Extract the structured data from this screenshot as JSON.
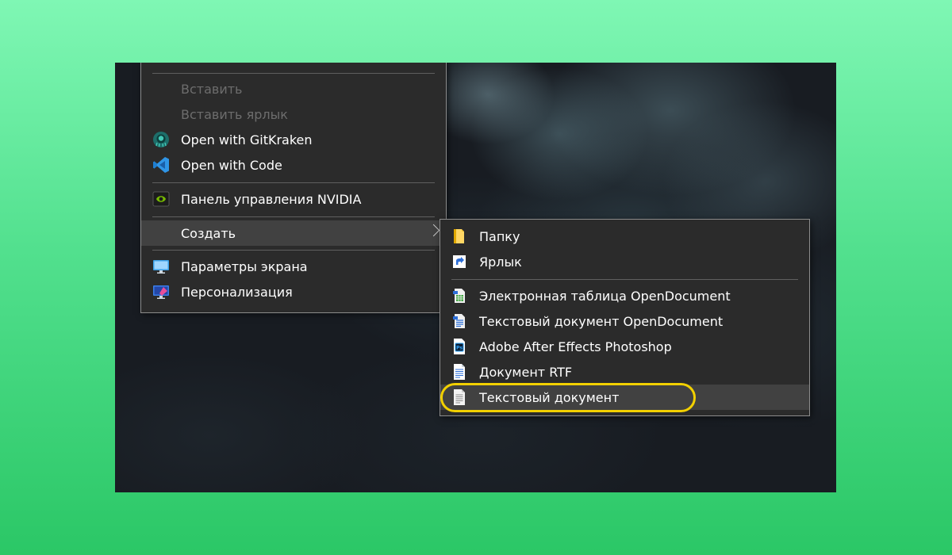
{
  "main_menu": {
    "items": [
      {
        "label": "Вставить",
        "enabled": false
      },
      {
        "label": "Вставить ярлык",
        "enabled": false
      },
      {
        "label": "Open with GitKraken",
        "icon": "gitkraken-icon"
      },
      {
        "label": "Open with Code",
        "icon": "vscode-icon"
      },
      {
        "label": "Панель управления NVIDIA",
        "icon": "nvidia-icon"
      },
      {
        "label": "Создать",
        "submenu": true
      },
      {
        "label": "Параметры экрана",
        "icon": "display-icon"
      },
      {
        "label": "Персонализация",
        "icon": "personalization-icon"
      }
    ]
  },
  "sub_menu": {
    "items": [
      {
        "label": "Папку",
        "icon": "folder-icon"
      },
      {
        "label": "Ярлык",
        "icon": "shortcut-icon"
      },
      {
        "label": "Электронная таблица OpenDocument",
        "icon": "ods-icon"
      },
      {
        "label": "Текстовый документ OpenDocument",
        "icon": "odt-icon"
      },
      {
        "label": "Adobe After Effects Photoshop",
        "icon": "photoshop-icon"
      },
      {
        "label": "Документ RTF",
        "icon": "rtf-icon"
      },
      {
        "label": "Текстовый документ",
        "icon": "text-document-icon",
        "highlighted": true
      }
    ]
  },
  "colors": {
    "menu_bg": "#2b2b2b",
    "hover_bg": "#414141",
    "highlight_ring": "#f2d000",
    "page_bg_top": "#7ff7b4",
    "page_bg_bottom": "#2bc766"
  }
}
